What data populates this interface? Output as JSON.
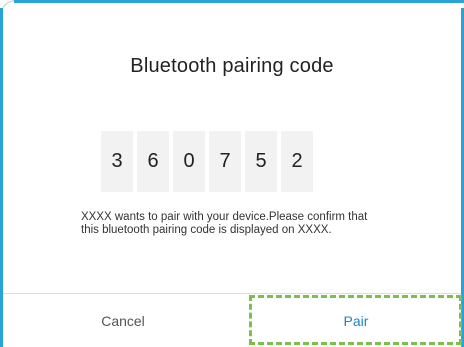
{
  "dialog": {
    "title": "Bluetooth pairing code",
    "code_digits": [
      "3",
      "6",
      "0",
      "7",
      "5",
      "2"
    ],
    "message": "XXXX wants to pair with your device.Please confirm that this bluetooth pairing code is displayed on XXXX.",
    "buttons": {
      "cancel_label": "Cancel",
      "pair_label": "Pair"
    }
  },
  "colors": {
    "frame_border": "#2aa3d8",
    "pair_text": "#1f86c2",
    "highlight": "#7cc04b",
    "digit_bg": "#f2f2f2"
  }
}
